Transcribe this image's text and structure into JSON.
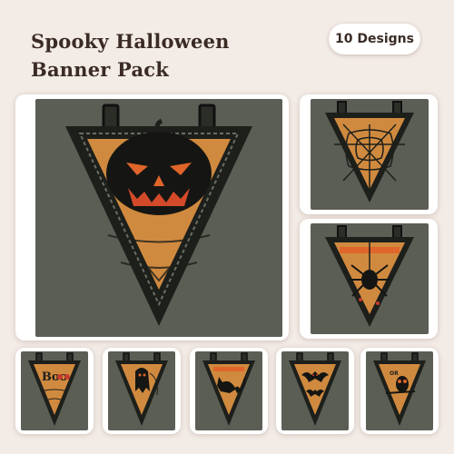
{
  "header": {
    "title_line1": "Spooky Halloween",
    "title_line2": "Banner Pack",
    "badge": "10 Designs"
  },
  "colors": {
    "fabric": "#5b5e55",
    "felt": "#d08a3f",
    "outline": "#1d1f1b",
    "accent_orange": "#e0652a",
    "accent_red": "#c73a2c"
  },
  "designs": [
    {
      "name": "jack-o-lantern-banner-icon",
      "featured": true
    },
    {
      "name": "spider-web-banner-icon"
    },
    {
      "name": "hanging-spider-banner-icon"
    },
    {
      "name": "boo-banner-icon",
      "text": "Boo"
    },
    {
      "name": "ghost-banner-icon"
    },
    {
      "name": "black-cat-banner-icon"
    },
    {
      "name": "bat-banner-icon"
    },
    {
      "name": "owl-banner-icon",
      "text": "OR"
    }
  ]
}
